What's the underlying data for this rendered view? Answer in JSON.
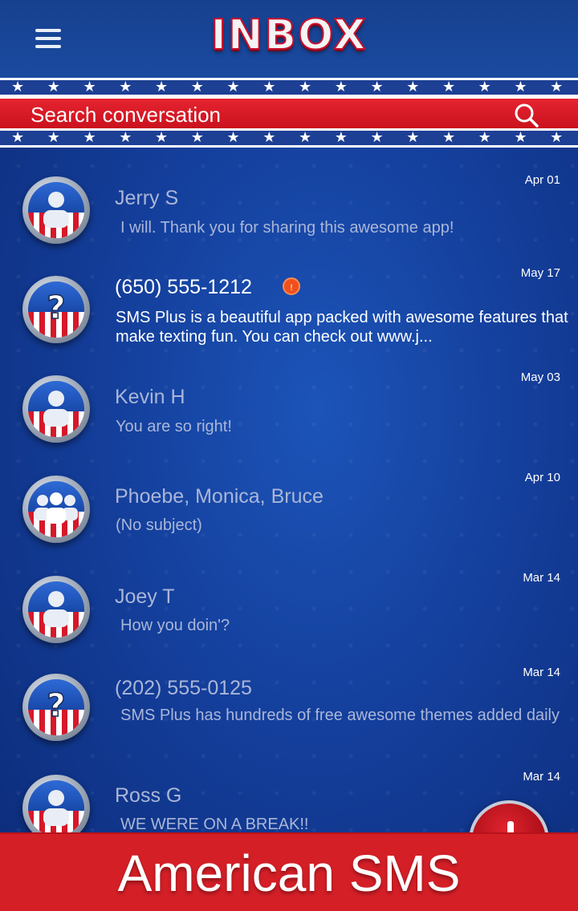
{
  "header": {
    "title": "INBOX",
    "menu_icon": "hamburger-menu-icon"
  },
  "search": {
    "placeholder": "Search conversation",
    "icon": "search-icon"
  },
  "conversations": [
    {
      "name": "Jerry S",
      "snippet": "I will. Thank you for sharing this awesome app!",
      "date": "Apr 01",
      "avatar": "person-icon",
      "unread": false
    },
    {
      "name": "(650) 555-1212",
      "snippet": "SMS Plus is a beautiful app packed with awesome features that make texting fun. You can check out www.j...",
      "date": "May 17",
      "avatar": "question-mark-icon",
      "unread": true,
      "badge": "!"
    },
    {
      "name": "Kevin H",
      "snippet": "You are so right!",
      "date": "May 03",
      "avatar": "person-icon",
      "unread": false
    },
    {
      "name": "Phoebe, Monica, Bruce",
      "snippet": "(No subject)",
      "date": "Apr 10",
      "avatar": "group-icon",
      "unread": false
    },
    {
      "name": "Joey T",
      "snippet": "How you doin'?",
      "date": "Mar 14",
      "avatar": "person-icon",
      "unread": false
    },
    {
      "name": "(202) 555-0125",
      "snippet": "SMS Plus has hundreds of free awesome themes added daily",
      "date": "Mar 14",
      "avatar": "question-mark-icon",
      "unread": false
    },
    {
      "name": "Ross G",
      "snippet": "WE WERE ON A BREAK!!",
      "date": "Mar 14",
      "avatar": "person-icon",
      "unread": false
    }
  ],
  "fab": {
    "icon": "compose-plus-icon"
  },
  "banner": {
    "text": "American SMS"
  },
  "colors": {
    "background": "#143f9c",
    "accent_red": "#d51f27",
    "unread_badge": "#f0501a",
    "read_text": "#aab6d8"
  }
}
